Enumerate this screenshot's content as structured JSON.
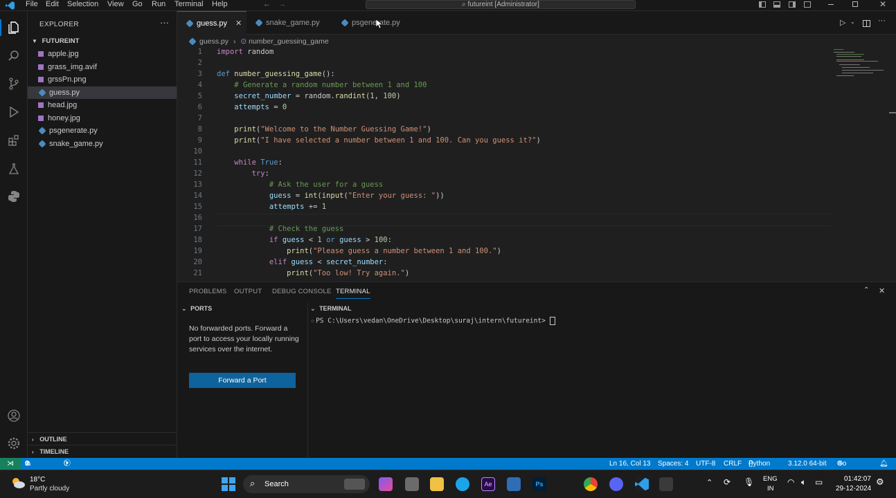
{
  "titlebar": {
    "menu": [
      "File",
      "Edit",
      "Selection",
      "View",
      "Go",
      "Run",
      "Terminal",
      "Help"
    ],
    "search_text": "futureint [Administrator]"
  },
  "explorer": {
    "title": "EXPLORER",
    "folder": "FUTUREINT",
    "files": [
      "apple.jpg",
      "grass_img.avif",
      "grssPn.png",
      "guess.py",
      "head.jpg",
      "honey.jpg",
      "psgenerate.py",
      "snake_game.py"
    ],
    "selected": "guess.py",
    "outline_label": "OUTLINE",
    "timeline_label": "TIMELINE"
  },
  "tabs": [
    {
      "label": "guess.py",
      "active": true
    },
    {
      "label": "snake_game.py",
      "active": false
    },
    {
      "label": "psgenerate.py",
      "active": false
    }
  ],
  "breadcrumb": {
    "file": "guess.py",
    "symbol": "number_guessing_game"
  },
  "editor": {
    "line_numbers": [
      "1",
      "2",
      "3",
      "4",
      "5",
      "6",
      "7",
      "8",
      "9",
      "10",
      "11",
      "12",
      "13",
      "14",
      "15",
      "16",
      "17",
      "18",
      "19",
      "20",
      "21"
    ]
  },
  "panel": {
    "tabs": [
      "PROBLEMS",
      "OUTPUT",
      "DEBUG CONSOLE",
      "TERMINAL"
    ],
    "active_tab": "TERMINAL",
    "ports_title": "PORTS",
    "ports_message": "No forwarded ports. Forward a port to access your locally running services over the internet.",
    "forward_button": "Forward a Port",
    "terminal_title": "TERMINAL",
    "terminal_prompt": "PS C:\\Users\\vedan\\OneDrive\\Desktop\\suraj\\intern\\futureint> "
  },
  "statusbar": {
    "errors": "0",
    "warnings": "0",
    "ports": "0",
    "position": "Ln 16, Col 13",
    "spaces": "Spaces: 4",
    "encoding": "UTF-8",
    "eol": "CRLF",
    "language": "Python",
    "interpreter": "3.12.0 64-bit",
    "golive": "Go Live"
  },
  "taskbar": {
    "weather_temp": "18°C",
    "weather_desc": "Partly cloudy",
    "search_label": "Search",
    "lang": "ENG",
    "region": "IN",
    "time": "01:42:07",
    "date": "29-12-2024"
  },
  "colors": {
    "accent": "#007acc",
    "active_tab_border": "#0078d4",
    "button": "#0e639c"
  }
}
